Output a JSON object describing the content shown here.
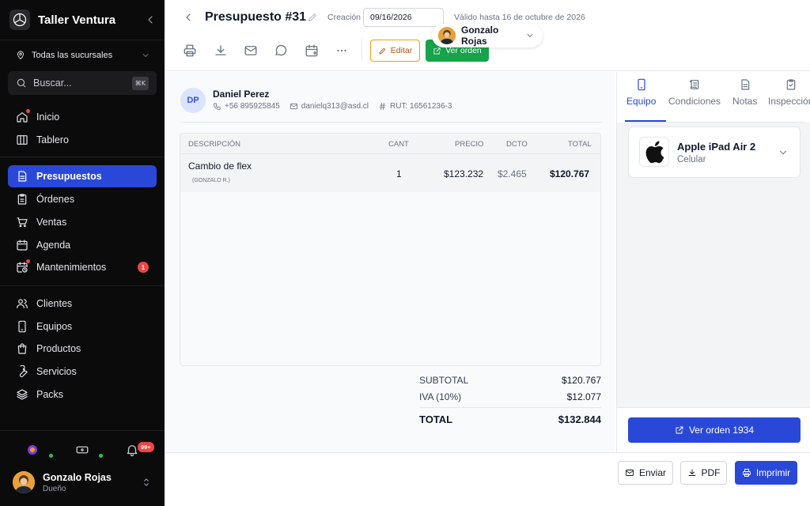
{
  "sidebar": {
    "brand": "Taller Ventura",
    "branch": "Todas las sucursales",
    "search_placeholder": "Buscar...",
    "search_shortcut": "⌘K",
    "items": [
      {
        "label": "Inicio",
        "icon": "home-icon"
      },
      {
        "label": "Tablero",
        "icon": "board-icon"
      },
      {
        "label": "Presupuestos",
        "icon": "document-icon",
        "active": true
      },
      {
        "label": "Órdenes",
        "icon": "clipboard-icon"
      },
      {
        "label": "Ventas",
        "icon": "cart-icon"
      },
      {
        "label": "Agenda",
        "icon": "calendar-icon"
      },
      {
        "label": "Mantenimientos",
        "icon": "calendar-clock-icon",
        "count": "1"
      },
      {
        "label": "Clientes",
        "icon": "users-icon"
      },
      {
        "label": "Equipos",
        "icon": "phone-icon"
      },
      {
        "label": "Productos",
        "icon": "bag-icon"
      },
      {
        "label": "Servicios",
        "icon": "wrench-icon"
      },
      {
        "label": "Packs",
        "icon": "layers-icon"
      }
    ],
    "notifications_badge": "99+",
    "user": {
      "name": "Gonzalo Rojas",
      "role": "Dueño"
    }
  },
  "header": {
    "title": "Presupuesto #31",
    "creation_label": "Creación",
    "creation_date": "09/16/2026",
    "valid_until": "Válido hasta 16 de octubre de 2026",
    "assignee": "Gonzalo Rojas",
    "edit_label": "Editar",
    "view_order_label": "Ver orden"
  },
  "client": {
    "initials": "DP",
    "name": "Daniel Perez",
    "phone": "+56 895925845",
    "email": "danielq313@asd.cl",
    "rut": "RUT: 16561236-3"
  },
  "table": {
    "headers": {
      "description": "DESCRIPCIÓN",
      "qty": "CANT",
      "price": "PRECIO",
      "discount": "DCTO",
      "total": "TOTAL"
    },
    "rows": [
      {
        "description": "Cambio de flex",
        "technician": "(GONZALO R.)",
        "qty": "1",
        "price": "$123.232",
        "discount": "$2.465",
        "total": "$120.767"
      }
    ]
  },
  "totals": {
    "subtotal_label": "SUBTOTAL",
    "subtotal": "$120.767",
    "tax_label": "IVA (10%)",
    "tax": "$12.077",
    "total_label": "TOTAL",
    "total": "$132.844"
  },
  "right": {
    "tabs": [
      "Equipo",
      "Condiciones",
      "Notas",
      "Inspección"
    ],
    "device": {
      "name": "Apple iPad Air 2",
      "type": "Celular"
    },
    "order_button": "Ver orden 1934"
  },
  "footer": {
    "send": "Enviar",
    "pdf": "PDF",
    "print": "Imprimir"
  },
  "colors": {
    "primary": "#2a48d8",
    "success": "#16a34a",
    "warning": "#f59e0b",
    "danger": "#ef4444",
    "sidebar_bg": "#0b0b0c"
  }
}
